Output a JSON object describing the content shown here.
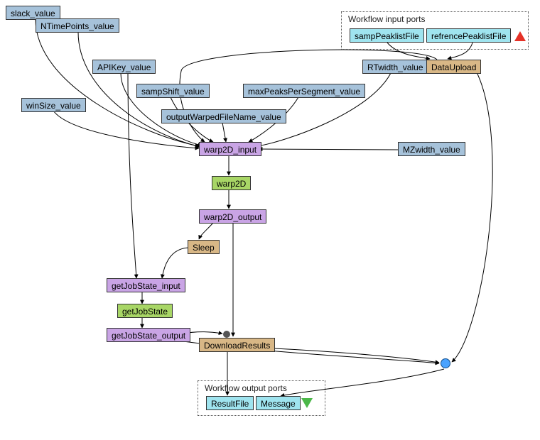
{
  "groups": {
    "inputs": {
      "label": "Workflow input ports"
    },
    "outputs": {
      "label": "Workflow output ports"
    }
  },
  "nodes": {
    "slack": "slack_value",
    "ntime": "NTimePoints_value",
    "apikey": "APIKey_value",
    "winsize": "winSize_value",
    "sampshift": "sampShift_value",
    "owfn": "outputWarpedFileName_value",
    "maxpeaks": "maxPeaksPerSegment_value",
    "rtwidth": "RTwidth_value",
    "mzwidth": "MZwidth_value",
    "samppeak": "sampPeaklistFile",
    "refpeak": "refrencePeaklistFile",
    "dataupload": "DataUpload",
    "warp_in": "warp2D_input",
    "warp": "warp2D",
    "warp_out": "warp2D_output",
    "sleep": "Sleep",
    "gjs_in": "getJobState_input",
    "gjs": "getJobState",
    "gjs_out": "getJobState_output",
    "dlres": "DownloadResults",
    "resultfile": "ResultFile",
    "message": "Message"
  },
  "edges": [
    [
      "slack",
      "warp_in"
    ],
    [
      "ntime",
      "warp_in"
    ],
    [
      "apikey",
      "warp_in"
    ],
    [
      "apikey",
      "gjs_in"
    ],
    [
      "winsize",
      "warp_in"
    ],
    [
      "sampshift",
      "warp_in"
    ],
    [
      "owfn",
      "warp_in"
    ],
    [
      "maxpeaks",
      "warp_in"
    ],
    [
      "rtwidth",
      "warp_in"
    ],
    [
      "mzwidth",
      "warp_in"
    ],
    [
      "samppeak",
      "dataupload"
    ],
    [
      "refpeak",
      "dataupload"
    ],
    [
      "dataupload",
      "warp_in"
    ],
    [
      "dataupload",
      "message"
    ],
    [
      "warp_in",
      "warp"
    ],
    [
      "warp",
      "warp_out"
    ],
    [
      "warp_out",
      "sleep"
    ],
    [
      "warp_out",
      "dlres"
    ],
    [
      "sleep",
      "gjs_in"
    ],
    [
      "gjs_in",
      "gjs"
    ],
    [
      "gjs",
      "gjs_out"
    ],
    [
      "gjs_out",
      "dlres"
    ],
    [
      "gjs_out",
      "message"
    ],
    [
      "dlres",
      "resultfile"
    ],
    [
      "dlres",
      "message"
    ]
  ]
}
